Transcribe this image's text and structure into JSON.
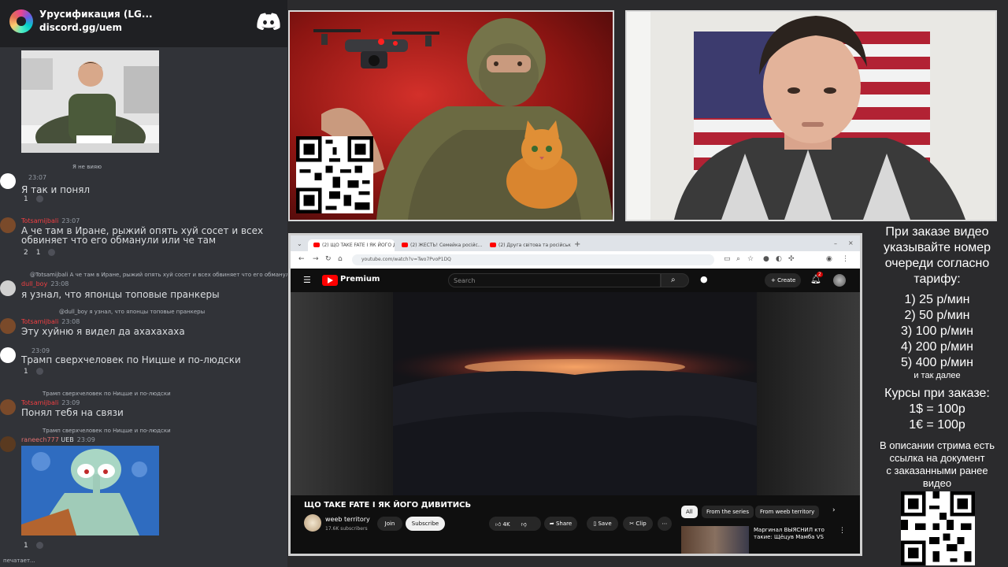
{
  "discord": {
    "server_name": "Урусификация (LG...",
    "server_link": "discord.gg/uem",
    "messages": [
      {
        "reply": "Я не вияю",
        "time": "23:07",
        "text": "Я так и понял",
        "reactions": [
          "1"
        ]
      },
      {
        "author": "Totsamijbali",
        "time": "23:07",
        "text_lines": [
          "А че там в Иране, рыжий опять хуй сосет и всех",
          "обвиняет что его обманули или че там"
        ],
        "reactions": [
          "2",
          "1"
        ]
      },
      {
        "reply": "@Totsamijbali А че там в Иране, рыжий опять хуй сосет и всех обвиняет что его обманули или ч",
        "author": "dull_boy",
        "time": "23:08",
        "text": "я узнал, что японцы топовые пранкеры"
      },
      {
        "reply": "@dull_boy я узнал, что японцы топовые пранкеры",
        "author": "Totsamijbali",
        "time": "23:08",
        "text": "Эту хуйню я видел да ахахахаха"
      },
      {
        "time": "23:09",
        "text": "Трамп сверхчеловек по Ницше и по-людски",
        "reactions": [
          "1"
        ]
      },
      {
        "reply": "Трамп сверхчеловек по Ницше и по-людски",
        "author": "Totsamijbali",
        "time": "23:09",
        "text": "Понял тебя на связи"
      },
      {
        "reply": "Трамп сверхчеловек по Ницше и по-людски",
        "author": "raneech777",
        "badge": "UEB",
        "time": "23:09",
        "reactions": [
          "1"
        ]
      }
    ],
    "typing": "печатает..."
  },
  "browser": {
    "tabs": [
      "(2) ЩО TAKE FATE І ЯК ЙОГО Д...",
      "(2) ЖЕСТЬ! Семейка російс...",
      "(2) Друга світова та російськ..."
    ],
    "url": "youtube.com/watch?v=Two7PvoP1DQ"
  },
  "youtube": {
    "brand": "Premium",
    "search_placeholder": "Search",
    "create_label": "Create",
    "notifications": "2",
    "video_title": "ЩО TAKE FATE І ЯК ЙОГО ДИВИТИСЬ",
    "channel": "weeb territory",
    "subscribers": "17.6K subscribers",
    "join": "Join",
    "subscribe": "Subscribe",
    "likes": "4K",
    "share": "Share",
    "save": "Save",
    "clip": "Clip",
    "chips": [
      "All",
      "From the series",
      "From weeb territory"
    ],
    "recommended_title": "Маргинал ВЫЯСНИЛ кто такие: Щёцув Мамба VS"
  },
  "info_panel": {
    "intro": [
      "При заказе видео",
      "указывайте номер",
      "очереди согласно",
      "тарифу:"
    ],
    "tariffs": [
      "1) 25 р/мин",
      "2) 50 р/мин",
      "3) 100 р/мин",
      "4) 200 р/мин",
      "5) 400 р/мин"
    ],
    "etc": "и так далее",
    "rates_title": "Курсы при заказе:",
    "rates": [
      "1$ = 100р",
      "1€ = 100р"
    ],
    "note": [
      "В описании стрима есть",
      "ссылка на документ",
      "с заказанными ранее",
      "видео"
    ]
  }
}
